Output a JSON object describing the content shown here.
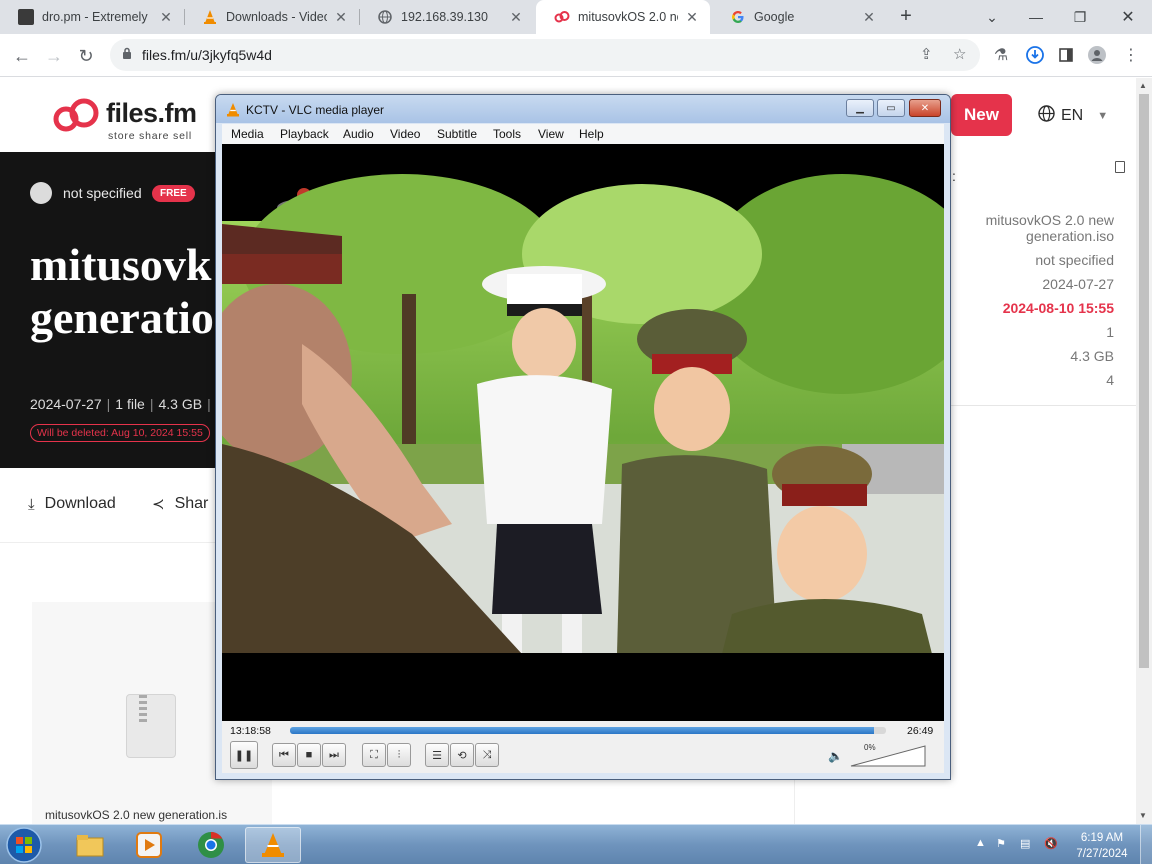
{
  "browser": {
    "tabs": [
      {
        "title": "dro.pm - Extremely",
        "icon": "dro-icon"
      },
      {
        "title": "Downloads - VideoL",
        "icon": "vlc-cone-icon"
      },
      {
        "title": "192.168.39.130",
        "icon": "globe-icon"
      },
      {
        "title": "mitusovkOS 2.0 nev",
        "icon": "filesfm-icon",
        "active": true
      },
      {
        "title": "Google",
        "icon": "google-icon"
      }
    ],
    "url": "files.fm/u/3jkyfq5w4d"
  },
  "filesfm": {
    "brand": "files.fm",
    "tagline": "store  share  sell",
    "owner": "not specified",
    "free_badge": "FREE",
    "title_line1": "mitusovk",
    "title_line2": "generatio",
    "meta_date": "2024-07-27",
    "meta_files": "1 file",
    "meta_size": "4.3 GB",
    "delete_notice": "Will be deleted: Aug 10, 2024 15:55",
    "download_label": "Download",
    "share_label": "Shar",
    "file_card_name": "mitusovkOS 2.0 new generation.is",
    "new_button": "New",
    "language": "EN",
    "side_colon": ":",
    "sidebar": {
      "name_line1": "mitusovkOS 2.0 new",
      "name_line2": "generation.iso",
      "owner": "not specified",
      "uploaded": "2024-07-27",
      "expires": "2024-08-10 15:55",
      "files": "1",
      "size": "4.3 GB",
      "count": "4"
    }
  },
  "vlc": {
    "title": "KCTV - VLC media player",
    "menu": [
      "Media",
      "Playback",
      "Audio",
      "Video",
      "Subtitle",
      "Tools",
      "View",
      "Help"
    ],
    "elapsed": "13:18:58",
    "remaining": "26:49",
    "seek_progress": 0.98,
    "volume": "0%"
  },
  "taskbar": {
    "time": "6:19 AM",
    "date": "7/27/2024"
  },
  "colors": {
    "accent_red": "#e5334b",
    "hero_bg": "#141414",
    "vlc_orange": "#f08c00"
  }
}
